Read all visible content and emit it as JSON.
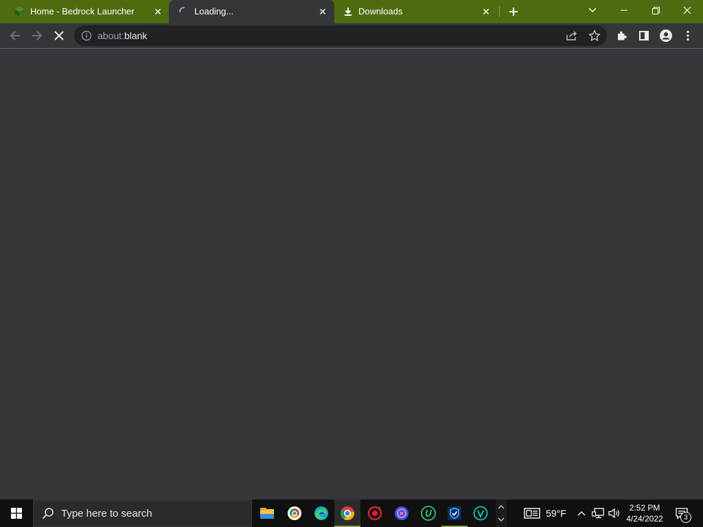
{
  "browser": {
    "tabs": [
      {
        "label": "Home - Bedrock Launcher",
        "icon": "minecraft-grass-block-icon",
        "active": false
      },
      {
        "label": "Loading...",
        "icon": "loading-spinner-icon",
        "active": true
      },
      {
        "label": "Downloads",
        "icon": "download-icon",
        "active": false
      }
    ],
    "close_glyph": "✕",
    "address": {
      "scheme": "about:",
      "host": "blank"
    },
    "accent_color": "#4f6b10",
    "background_color": "#35363a"
  },
  "taskbar": {
    "search_placeholder": "Type here to search",
    "weather": "59°F",
    "time": "2:52 PM",
    "date": "4/24/2022",
    "notification_count": "3",
    "apps": [
      "file-explorer-icon",
      "brave-browser-icon",
      "edge-icon",
      "chrome-icon",
      "red-app-icon",
      "purple-app-icon",
      "green-u-app-icon",
      "blue-shield-app-icon",
      "teal-v-app-icon"
    ]
  }
}
